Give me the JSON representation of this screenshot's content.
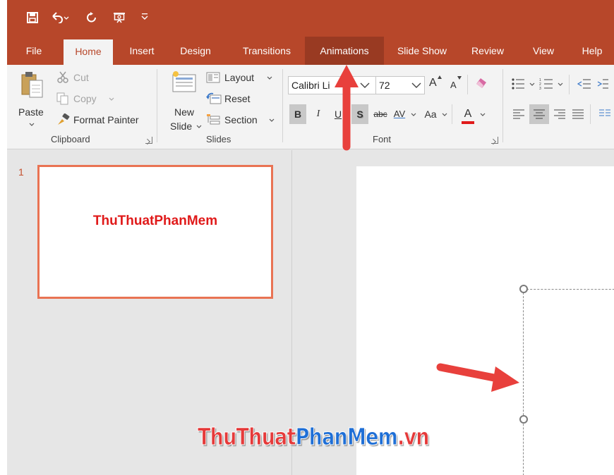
{
  "colors": {
    "accent": "#b7472a",
    "tab_hover": "#993a22",
    "thumb_border": "#e97353",
    "annotation_arrow": "#e8403c",
    "thumb_text": "#e01a1a"
  },
  "quick_access": {
    "icons": [
      "save-icon",
      "undo-icon",
      "redo-icon",
      "presentation-icon",
      "customize-icon"
    ]
  },
  "tabs": [
    {
      "label": "File"
    },
    {
      "label": "Home",
      "active": true
    },
    {
      "label": "Insert"
    },
    {
      "label": "Design"
    },
    {
      "label": "Transitions"
    },
    {
      "label": "Animations",
      "hovered": true
    },
    {
      "label": "Slide Show"
    },
    {
      "label": "Review"
    },
    {
      "label": "View"
    },
    {
      "label": "Help"
    }
  ],
  "ribbon": {
    "clipboard": {
      "paste": "Paste",
      "cut": "Cut",
      "copy": "Copy",
      "format_painter": "Format Painter",
      "label": "Clipboard"
    },
    "slides": {
      "new_slide_line1": "New",
      "new_slide_line2": "Slide",
      "layout": "Layout",
      "reset": "Reset",
      "section": "Section",
      "label": "Slides"
    },
    "font": {
      "font_name": "Calibri Li",
      "font_size": "72",
      "grow": "A",
      "shrink": "A",
      "bold": "B",
      "italic": "I",
      "underline": "U",
      "shadow": "S",
      "strikethrough": "abc",
      "spacing": "AV",
      "change_case": "Aa",
      "font_color": "A",
      "label": "Font"
    }
  },
  "slides": [
    {
      "number": "1",
      "thumbnail_text": "ThuThuatPhanMem"
    }
  ],
  "watermark": {
    "part1": "ThuThuat",
    "part2": "PhanMem",
    "part3": ".vn"
  }
}
